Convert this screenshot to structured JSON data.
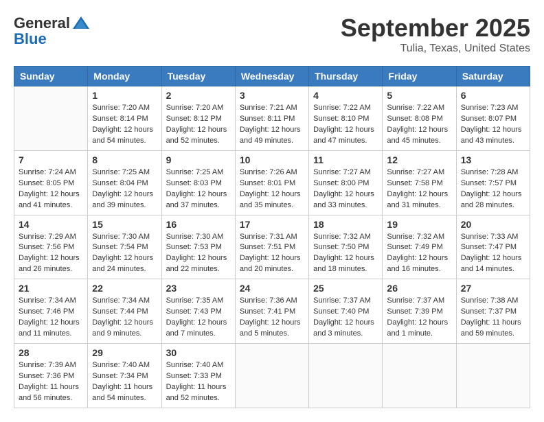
{
  "header": {
    "logo_line1": "General",
    "logo_line2": "Blue",
    "month": "September 2025",
    "location": "Tulia, Texas, United States"
  },
  "weekdays": [
    "Sunday",
    "Monday",
    "Tuesday",
    "Wednesday",
    "Thursday",
    "Friday",
    "Saturday"
  ],
  "weeks": [
    [
      {
        "day": "",
        "info": ""
      },
      {
        "day": "1",
        "info": "Sunrise: 7:20 AM\nSunset: 8:14 PM\nDaylight: 12 hours\nand 54 minutes."
      },
      {
        "day": "2",
        "info": "Sunrise: 7:20 AM\nSunset: 8:12 PM\nDaylight: 12 hours\nand 52 minutes."
      },
      {
        "day": "3",
        "info": "Sunrise: 7:21 AM\nSunset: 8:11 PM\nDaylight: 12 hours\nand 49 minutes."
      },
      {
        "day": "4",
        "info": "Sunrise: 7:22 AM\nSunset: 8:10 PM\nDaylight: 12 hours\nand 47 minutes."
      },
      {
        "day": "5",
        "info": "Sunrise: 7:22 AM\nSunset: 8:08 PM\nDaylight: 12 hours\nand 45 minutes."
      },
      {
        "day": "6",
        "info": "Sunrise: 7:23 AM\nSunset: 8:07 PM\nDaylight: 12 hours\nand 43 minutes."
      }
    ],
    [
      {
        "day": "7",
        "info": "Sunrise: 7:24 AM\nSunset: 8:05 PM\nDaylight: 12 hours\nand 41 minutes."
      },
      {
        "day": "8",
        "info": "Sunrise: 7:25 AM\nSunset: 8:04 PM\nDaylight: 12 hours\nand 39 minutes."
      },
      {
        "day": "9",
        "info": "Sunrise: 7:25 AM\nSunset: 8:03 PM\nDaylight: 12 hours\nand 37 minutes."
      },
      {
        "day": "10",
        "info": "Sunrise: 7:26 AM\nSunset: 8:01 PM\nDaylight: 12 hours\nand 35 minutes."
      },
      {
        "day": "11",
        "info": "Sunrise: 7:27 AM\nSunset: 8:00 PM\nDaylight: 12 hours\nand 33 minutes."
      },
      {
        "day": "12",
        "info": "Sunrise: 7:27 AM\nSunset: 7:58 PM\nDaylight: 12 hours\nand 31 minutes."
      },
      {
        "day": "13",
        "info": "Sunrise: 7:28 AM\nSunset: 7:57 PM\nDaylight: 12 hours\nand 28 minutes."
      }
    ],
    [
      {
        "day": "14",
        "info": "Sunrise: 7:29 AM\nSunset: 7:56 PM\nDaylight: 12 hours\nand 26 minutes."
      },
      {
        "day": "15",
        "info": "Sunrise: 7:30 AM\nSunset: 7:54 PM\nDaylight: 12 hours\nand 24 minutes."
      },
      {
        "day": "16",
        "info": "Sunrise: 7:30 AM\nSunset: 7:53 PM\nDaylight: 12 hours\nand 22 minutes."
      },
      {
        "day": "17",
        "info": "Sunrise: 7:31 AM\nSunset: 7:51 PM\nDaylight: 12 hours\nand 20 minutes."
      },
      {
        "day": "18",
        "info": "Sunrise: 7:32 AM\nSunset: 7:50 PM\nDaylight: 12 hours\nand 18 minutes."
      },
      {
        "day": "19",
        "info": "Sunrise: 7:32 AM\nSunset: 7:49 PM\nDaylight: 12 hours\nand 16 minutes."
      },
      {
        "day": "20",
        "info": "Sunrise: 7:33 AM\nSunset: 7:47 PM\nDaylight: 12 hours\nand 14 minutes."
      }
    ],
    [
      {
        "day": "21",
        "info": "Sunrise: 7:34 AM\nSunset: 7:46 PM\nDaylight: 12 hours\nand 11 minutes."
      },
      {
        "day": "22",
        "info": "Sunrise: 7:34 AM\nSunset: 7:44 PM\nDaylight: 12 hours\nand 9 minutes."
      },
      {
        "day": "23",
        "info": "Sunrise: 7:35 AM\nSunset: 7:43 PM\nDaylight: 12 hours\nand 7 minutes."
      },
      {
        "day": "24",
        "info": "Sunrise: 7:36 AM\nSunset: 7:41 PM\nDaylight: 12 hours\nand 5 minutes."
      },
      {
        "day": "25",
        "info": "Sunrise: 7:37 AM\nSunset: 7:40 PM\nDaylight: 12 hours\nand 3 minutes."
      },
      {
        "day": "26",
        "info": "Sunrise: 7:37 AM\nSunset: 7:39 PM\nDaylight: 12 hours\nand 1 minute."
      },
      {
        "day": "27",
        "info": "Sunrise: 7:38 AM\nSunset: 7:37 PM\nDaylight: 11 hours\nand 59 minutes."
      }
    ],
    [
      {
        "day": "28",
        "info": "Sunrise: 7:39 AM\nSunset: 7:36 PM\nDaylight: 11 hours\nand 56 minutes."
      },
      {
        "day": "29",
        "info": "Sunrise: 7:40 AM\nSunset: 7:34 PM\nDaylight: 11 hours\nand 54 minutes."
      },
      {
        "day": "30",
        "info": "Sunrise: 7:40 AM\nSunset: 7:33 PM\nDaylight: 11 hours\nand 52 minutes."
      },
      {
        "day": "",
        "info": ""
      },
      {
        "day": "",
        "info": ""
      },
      {
        "day": "",
        "info": ""
      },
      {
        "day": "",
        "info": ""
      }
    ]
  ]
}
